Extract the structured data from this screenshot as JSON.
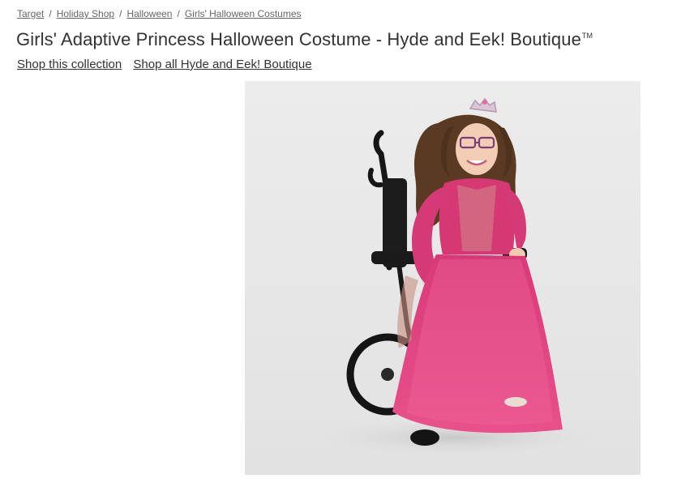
{
  "breadcrumb": {
    "items": [
      {
        "label": "Target"
      },
      {
        "label": "Holiday Shop"
      },
      {
        "label": "Halloween"
      },
      {
        "label": "Girls' Halloween Costumes"
      }
    ],
    "separator": "/"
  },
  "product": {
    "title": "Girls' Adaptive Princess Halloween Costume - Hyde and Eek! Boutique",
    "trademark": "TM"
  },
  "links": {
    "shop_collection": "Shop this collection",
    "shop_all_brand": "Shop all Hyde and Eek! Boutique"
  },
  "image": {
    "background_color": "#e8e8e8",
    "dress_color": "#e0467f",
    "chair_color": "#1a1a1a"
  }
}
